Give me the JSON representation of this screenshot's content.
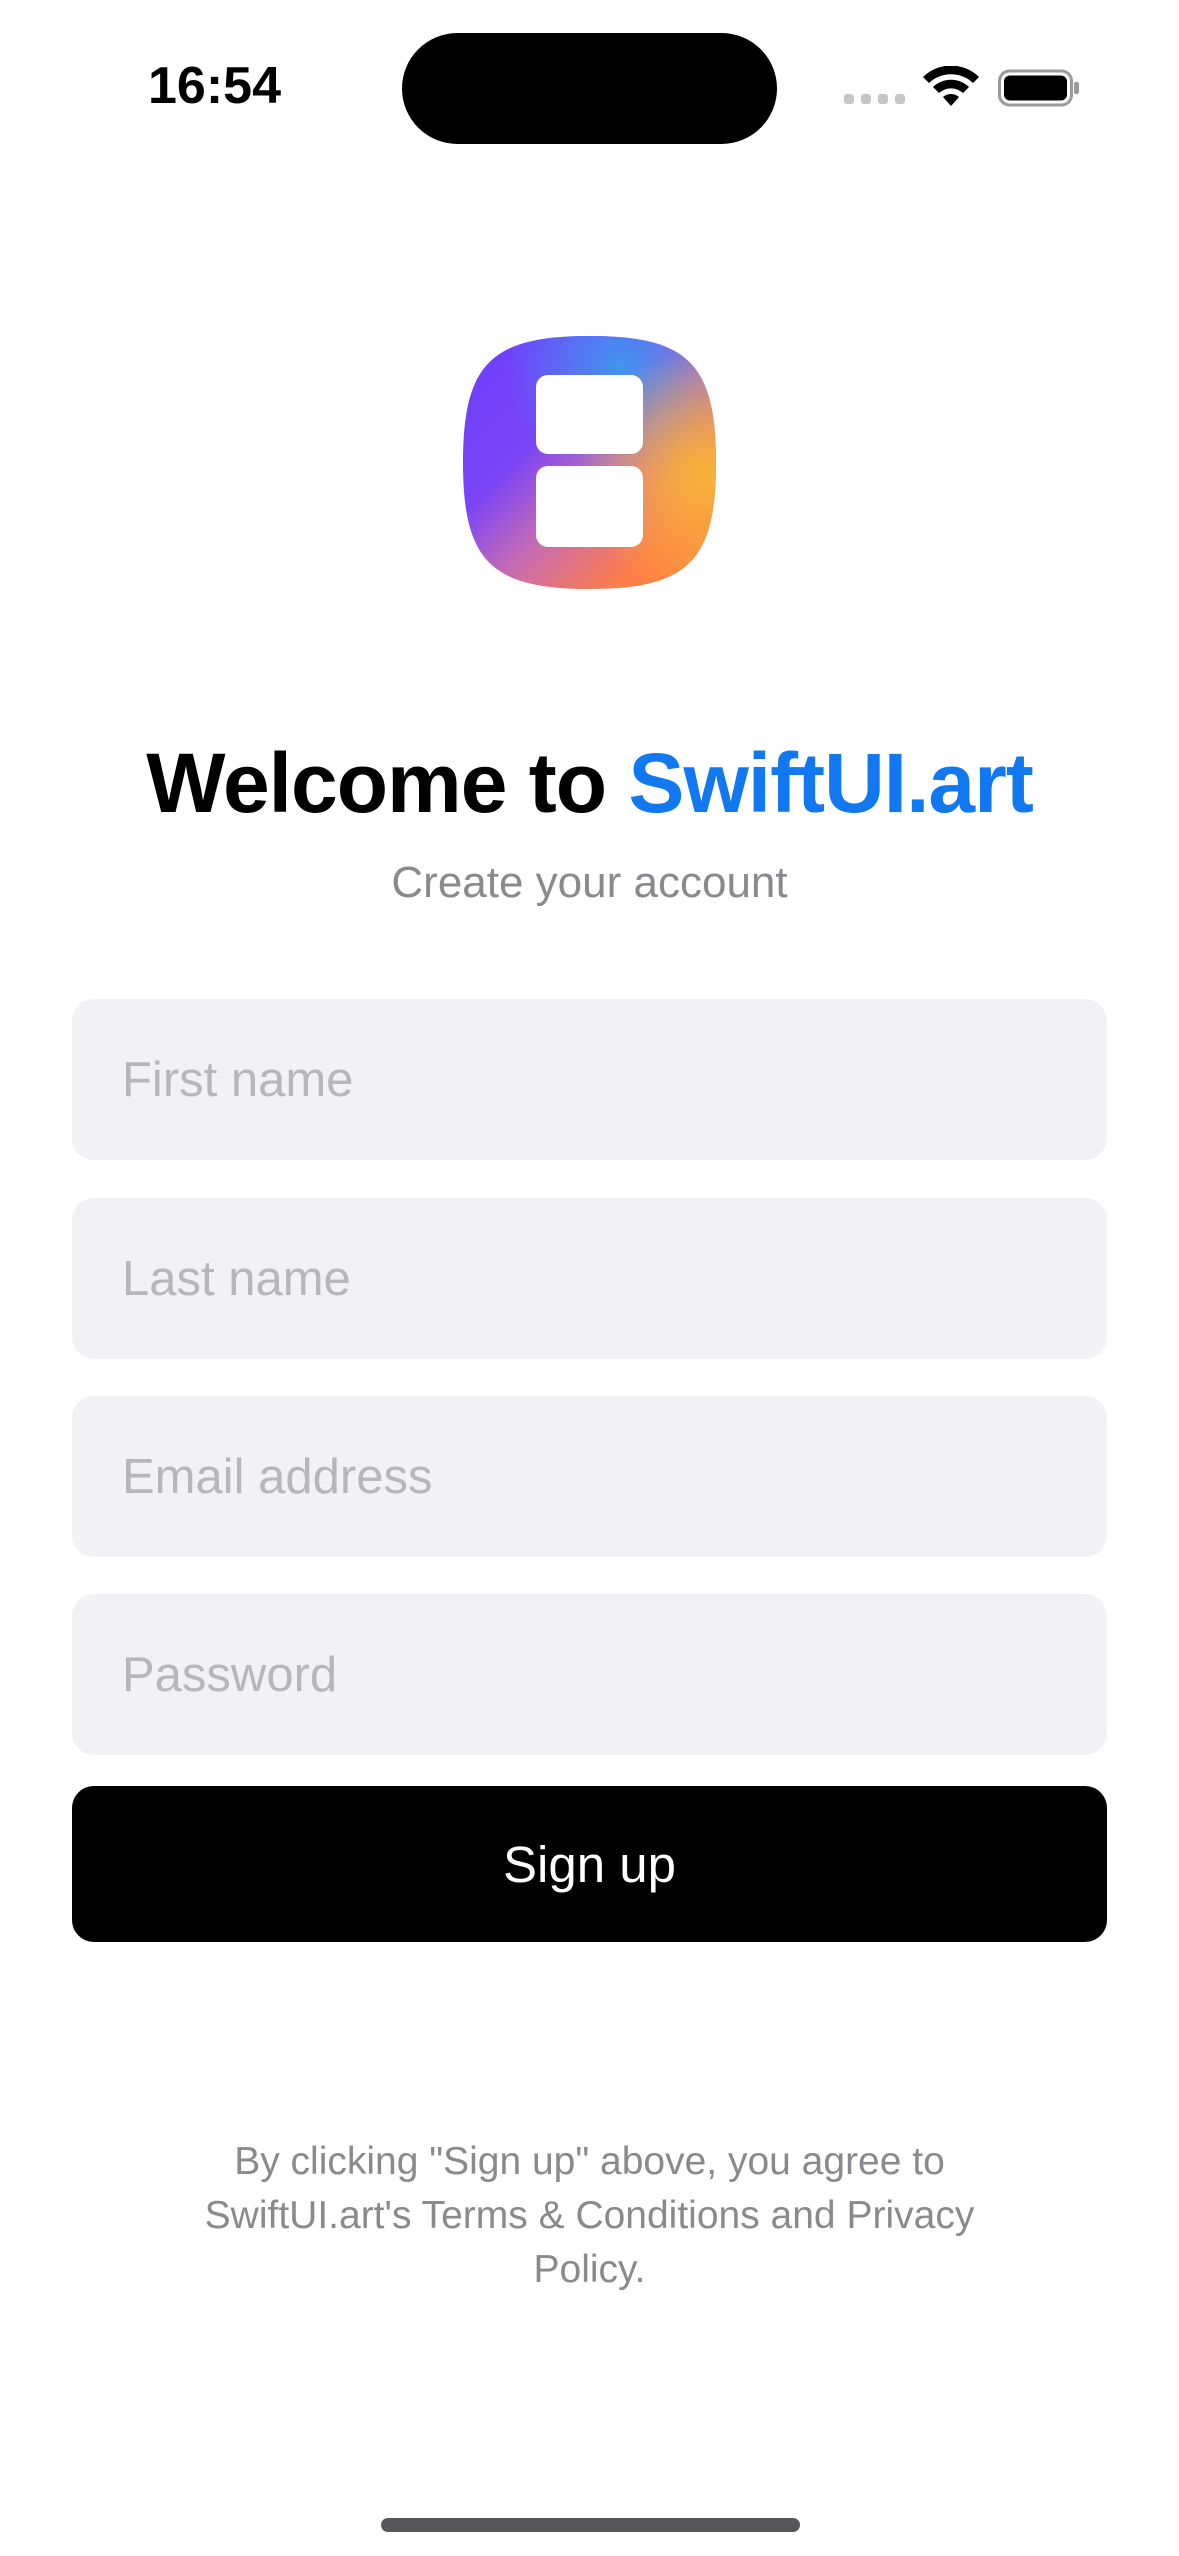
{
  "status_bar": {
    "time": "16:54",
    "signal_icon": "cellular-signal-icon",
    "wifi_icon": "wifi-icon",
    "battery_icon": "battery-icon"
  },
  "logo": {
    "icon": "app-logo-icon",
    "colors": [
      "#6b46ff",
      "#3b8ef5",
      "#f5b13c",
      "#ff7a45"
    ]
  },
  "header": {
    "title_prefix": "Welcome to",
    "title_brand": "SwiftUI.art",
    "brand_color": "#1278f0",
    "subtitle": "Create your account"
  },
  "form": {
    "first_name_placeholder": "First name",
    "last_name_placeholder": "Last name",
    "email_placeholder": "Email address",
    "password_placeholder": "Password",
    "first_name_value": "",
    "last_name_value": "",
    "email_value": "",
    "password_value": "",
    "signup_label": "Sign up"
  },
  "footer": {
    "terms_text": "By clicking \"Sign up\" above, you agree to SwiftUI.art's Terms & Conditions and Privacy Policy."
  }
}
